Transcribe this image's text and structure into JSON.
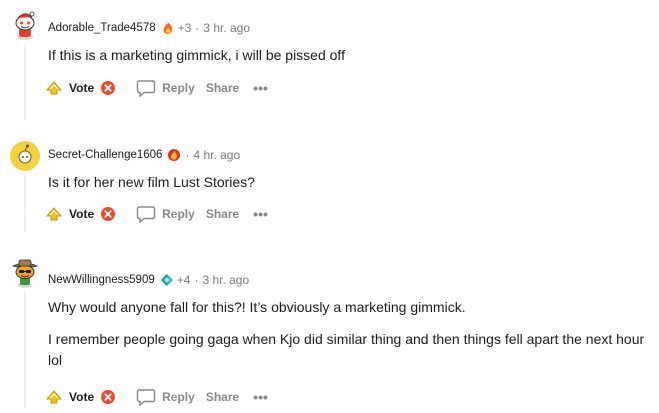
{
  "comments": [
    {
      "username": "Adorable_Trade4578",
      "awards": "+3",
      "separator": "·",
      "time": "3 hr. ago",
      "paragraphs": [
        "If this is a marketing gimmick, i will be pissed off"
      ],
      "vote_label": "Vote",
      "reply_label": "Reply",
      "share_label": "Share",
      "more_label": "•••"
    },
    {
      "username": "Secret-Challenge1606",
      "awards": "",
      "separator": "·",
      "time": "4 hr. ago",
      "paragraphs": [
        "Is it for her new film Lust Stories?"
      ],
      "vote_label": "Vote",
      "reply_label": "Reply",
      "share_label": "Share",
      "more_label": "•••"
    },
    {
      "username": "NewWillingness5909",
      "awards": "+4",
      "separator": "·",
      "time": "3 hr. ago",
      "paragraphs": [
        "Why would anyone fall for this?! It’s obviously a marketing gimmick.",
        "I remember people going gaga when Kjo did similar thing and then things fell apart the next hour lol"
      ],
      "vote_label": "Vote",
      "reply_label": "Reply",
      "share_label": "Share",
      "more_label": "•••"
    }
  ],
  "icons": {
    "flair_1": "fire-award-icon",
    "flair_2": "flame-award-icon",
    "flair_3": "diamond-award-icon",
    "upvote": "upvote-arrow-icon",
    "downvote": "downvote-icon",
    "reply": "speech-bubble-icon"
  },
  "colors": {
    "upvote": "#f0c419",
    "downvote": "#ea4c2e",
    "meta_gray": "#787c7e",
    "action_gray": "#878a8c",
    "thread_line": "#edeff1"
  }
}
